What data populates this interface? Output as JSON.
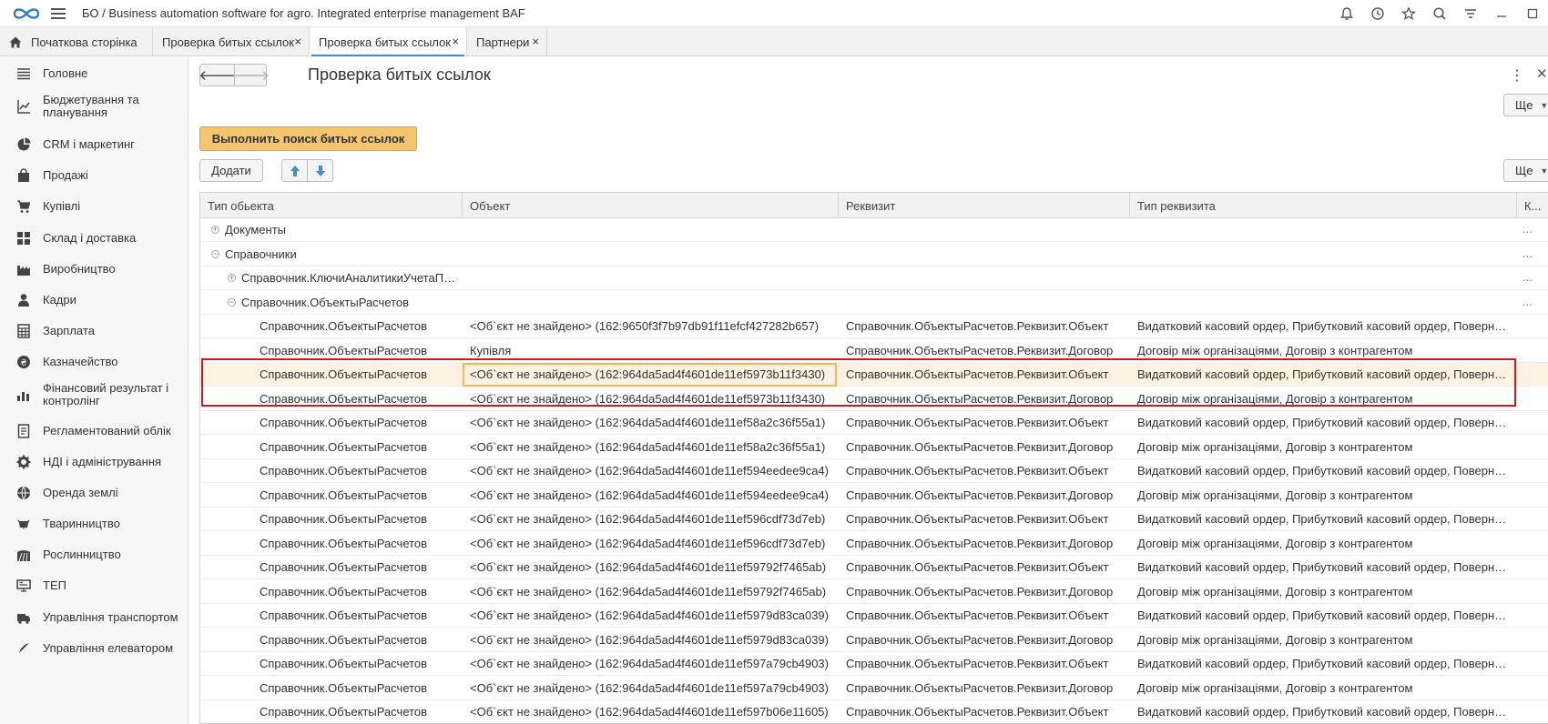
{
  "app": {
    "title": "БО / Business automation software for agro. Integrated enterprise management BAF"
  },
  "tabs": [
    {
      "label": "Початкова сторінка"
    },
    {
      "label": "Проверка битых ссылок"
    },
    {
      "label": "Проверка битых ссылок"
    },
    {
      "label": "Партнери"
    }
  ],
  "tab_close": "×",
  "sidebar": {
    "items": [
      {
        "label": "Головне",
        "icon": "menu-lines-icon"
      },
      {
        "label": "Бюджетування та планування",
        "icon": "chart-line-icon"
      },
      {
        "label": "CRM і маркетинг",
        "icon": "pie-chart-icon"
      },
      {
        "label": "Продажі",
        "icon": "shopping-bag-icon"
      },
      {
        "label": "Купівлі",
        "icon": "cart-icon"
      },
      {
        "label": "Склад і доставка",
        "icon": "warehouse-grid-icon"
      },
      {
        "label": "Виробництво",
        "icon": "factory-icon"
      },
      {
        "label": "Кадри",
        "icon": "person-icon"
      },
      {
        "label": "Зарплата",
        "icon": "calculator-icon"
      },
      {
        "label": "Казначейство",
        "icon": "coin-icon"
      },
      {
        "label": "Фінансовий результат і контролінг",
        "icon": "bar-chart-icon"
      },
      {
        "label": "Регламентований облік",
        "icon": "document-icon"
      },
      {
        "label": "НДІ і адміністрування",
        "icon": "gear-icon"
      },
      {
        "label": "Оренда землі",
        "icon": "globe-icon"
      },
      {
        "label": "Тваринництво",
        "icon": "cow-icon"
      },
      {
        "label": "Рослинництво",
        "icon": "field-icon"
      },
      {
        "label": "ТЕП",
        "icon": "monitor-icon"
      },
      {
        "label": "Управління транспортом",
        "icon": "truck-icon"
      },
      {
        "label": "Управління елеватором",
        "icon": "feather-icon"
      }
    ]
  },
  "main": {
    "page_title": "Проверка битых ссылок",
    "more_label": "Ще",
    "run_button": "Выполнить поиск битых ссылок",
    "add_button": "Додати",
    "columns": [
      "Тип обьекта",
      "Объект",
      "Реквизит",
      "Тип реквизита",
      "К..."
    ],
    "row_more": "...",
    "groups": [
      {
        "label": "Документы",
        "expander": "⊕"
      },
      {
        "label": "Справочники",
        "expander": "⊖"
      },
      {
        "label": "Справочник.КлючиАналитикиУчетаПо...",
        "expander": "⊕"
      },
      {
        "label": "Справочник.ОбъектыРасчетов",
        "expander": "⊖"
      }
    ],
    "rows": [
      {
        "type": "Справочник.ОбъектыРасчетов",
        "object": "<Об`єкт не знайдено> (162:9650f3f7b97db91f11efcf427282b657)",
        "attr": "Справочник.ОбъектыРасчетов.Реквизит.Объект",
        "attr_type": "Видатковий касовий ордер, Прибутковий касовий ордер, Поверне..."
      },
      {
        "type": "Справочник.ОбъектыРасчетов",
        "object": "Купівля",
        "attr": "Справочник.ОбъектыРасчетов.Реквизит.Договор",
        "attr_type": "Договір між організаціями, Договір з контрагентом"
      },
      {
        "type": "Справочник.ОбъектыРасчетов",
        "object": "<Об`єкт не знайдено> (162:964da5ad4f4601de11ef5973b11f3430)",
        "attr": "Справочник.ОбъектыРасчетов.Реквизит.Объект",
        "attr_type": "Видатковий касовий ордер, Прибутковий касовий ордер, Поверне..."
      },
      {
        "type": "Справочник.ОбъектыРасчетов",
        "object": "<Об`єкт не знайдено> (162:964da5ad4f4601de11ef5973b11f3430)",
        "attr": "Справочник.ОбъектыРасчетов.Реквизит.Договор",
        "attr_type": "Договір між організаціями, Договір з контрагентом"
      },
      {
        "type": "Справочник.ОбъектыРасчетов",
        "object": "<Об`єкт не знайдено> (162:964da5ad4f4601de11ef58a2c36f55a1)",
        "attr": "Справочник.ОбъектыРасчетов.Реквизит.Объект",
        "attr_type": "Видатковий касовий ордер, Прибутковий касовий ордер, Поверне..."
      },
      {
        "type": "Справочник.ОбъектыРасчетов",
        "object": "<Об`єкт не знайдено> (162:964da5ad4f4601de11ef58a2c36f55a1)",
        "attr": "Справочник.ОбъектыРасчетов.Реквизит.Договор",
        "attr_type": "Договір між організаціями, Договір з контрагентом"
      },
      {
        "type": "Справочник.ОбъектыРасчетов",
        "object": "<Об`єкт не знайдено> (162:964da5ad4f4601de11ef594eedee9ca4)",
        "attr": "Справочник.ОбъектыРасчетов.Реквизит.Объект",
        "attr_type": "Видатковий касовий ордер, Прибутковий касовий ордер, Поверне..."
      },
      {
        "type": "Справочник.ОбъектыРасчетов",
        "object": "<Об`єкт не знайдено> (162:964da5ad4f4601de11ef594eedee9ca4)",
        "attr": "Справочник.ОбъектыРасчетов.Реквизит.Договор",
        "attr_type": "Договір між організаціями, Договір з контрагентом"
      },
      {
        "type": "Справочник.ОбъектыРасчетов",
        "object": "<Об`єкт не знайдено> (162:964da5ad4f4601de11ef596cdf73d7eb)",
        "attr": "Справочник.ОбъектыРасчетов.Реквизит.Объект",
        "attr_type": "Видатковий касовий ордер, Прибутковий касовий ордер, Поверне..."
      },
      {
        "type": "Справочник.ОбъектыРасчетов",
        "object": "<Об`єкт не знайдено> (162:964da5ad4f4601de11ef596cdf73d7eb)",
        "attr": "Справочник.ОбъектыРасчетов.Реквизит.Договор",
        "attr_type": "Договір між організаціями, Договір з контрагентом"
      },
      {
        "type": "Справочник.ОбъектыРасчетов",
        "object": "<Об`єкт не знайдено> (162:964da5ad4f4601de11ef59792f7465ab)",
        "attr": "Справочник.ОбъектыРасчетов.Реквизит.Объект",
        "attr_type": "Видатковий касовий ордер, Прибутковий касовий ордер, Поверне..."
      },
      {
        "type": "Справочник.ОбъектыРасчетов",
        "object": "<Об`єкт не знайдено> (162:964da5ad4f4601de11ef59792f7465ab)",
        "attr": "Справочник.ОбъектыРасчетов.Реквизит.Договор",
        "attr_type": "Договір між організаціями, Договір з контрагентом"
      },
      {
        "type": "Справочник.ОбъектыРасчетов",
        "object": "<Об`єкт не знайдено> (162:964da5ad4f4601de11ef5979d83ca039)",
        "attr": "Справочник.ОбъектыРасчетов.Реквизит.Объект",
        "attr_type": "Видатковий касовий ордер, Прибутковий касовий ордер, Поверне..."
      },
      {
        "type": "Справочник.ОбъектыРасчетов",
        "object": "<Об`єкт не знайдено> (162:964da5ad4f4601de11ef5979d83ca039)",
        "attr": "Справочник.ОбъектыРасчетов.Реквизит.Договор",
        "attr_type": "Договір між організаціями, Договір з контрагентом"
      },
      {
        "type": "Справочник.ОбъектыРасчетов",
        "object": "<Об`єкт не знайдено> (162:964da5ad4f4601de11ef597a79cb4903)",
        "attr": "Справочник.ОбъектыРасчетов.Реквизит.Объект",
        "attr_type": "Видатковий касовий ордер, Прибутковий касовий ордер, Поверне..."
      },
      {
        "type": "Справочник.ОбъектыРасчетов",
        "object": "<Об`єкт не знайдено> (162:964da5ad4f4601de11ef597a79cb4903)",
        "attr": "Справочник.ОбъектыРасчетов.Реквизит.Договор",
        "attr_type": "Договір між організаціями, Договір з контрагентом"
      },
      {
        "type": "Справочник.ОбъектыРасчетов",
        "object": "<Об`єкт не знайдено> (162:964da5ad4f4601de11ef597b06e11605)",
        "attr": "Справочник.ОбъектыРасчетов.Реквизит.Объект",
        "attr_type": "Видатковий касовий ордер, Прибутковий касовий ордер, Поверне..."
      }
    ]
  },
  "colors": {
    "accent_tab": "#3b8fd6",
    "run_button": "#f5c46f",
    "selection": "#fdf2e2",
    "highlight_frame": "#d0191c"
  }
}
